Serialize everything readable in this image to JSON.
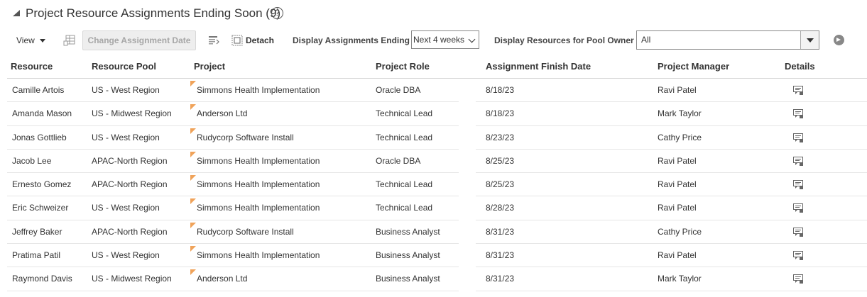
{
  "header": {
    "title": "Project Resource Assignments Ending Soon (9)",
    "help_symbol": "?"
  },
  "toolbar": {
    "view_label": "View",
    "change_date_label": "Change Assignment Date",
    "detach_label": "Detach",
    "ending_label": "Display Assignments Ending",
    "ending_value": "Next 4 weeks",
    "pool_owner_label": "Display Resources for Pool Owner",
    "pool_owner_value": "All"
  },
  "columns": {
    "resource": "Resource",
    "pool": "Resource Pool",
    "project": "Project",
    "role": "Project Role",
    "finish": "Assignment Finish Date",
    "manager": "Project Manager",
    "details": "Details"
  },
  "rows": [
    {
      "resource": "Camille Artois",
      "pool": "US - West Region",
      "project": "Simmons Health Implementation",
      "role": "Oracle DBA",
      "finish": "8/18/23",
      "manager": "Ravi Patel"
    },
    {
      "resource": "Amanda Mason",
      "pool": "US - Midwest Region",
      "project": "Anderson Ltd",
      "role": "Technical Lead",
      "finish": "8/18/23",
      "manager": "Mark Taylor"
    },
    {
      "resource": "Jonas Gottlieb",
      "pool": "US - West Region",
      "project": "Rudycorp Software Install",
      "role": "Technical Lead",
      "finish": "8/23/23",
      "manager": "Cathy Price"
    },
    {
      "resource": "Jacob Lee",
      "pool": "APAC-North Region",
      "project": "Simmons Health Implementation",
      "role": "Oracle DBA",
      "finish": "8/25/23",
      "manager": "Ravi Patel"
    },
    {
      "resource": "Ernesto Gomez",
      "pool": "APAC-North Region",
      "project": "Simmons Health Implementation",
      "role": "Technical Lead",
      "finish": "8/25/23",
      "manager": "Ravi Patel"
    },
    {
      "resource": "Eric Schweizer",
      "pool": "US - West Region",
      "project": "Simmons Health Implementation",
      "role": "Technical Lead",
      "finish": "8/28/23",
      "manager": "Ravi Patel"
    },
    {
      "resource": "Jeffrey Baker",
      "pool": "APAC-North Region",
      "project": "Rudycorp Software Install",
      "role": "Business Analyst",
      "finish": "8/31/23",
      "manager": "Cathy Price"
    },
    {
      "resource": "Pratima Patil",
      "pool": "US - West Region",
      "project": "Simmons Health Implementation",
      "role": "Business Analyst",
      "finish": "8/31/23",
      "manager": "Ravi Patel"
    },
    {
      "resource": "Raymond Davis",
      "pool": "US - Midwest Region",
      "project": "Anderson Ltd",
      "role": "Business Analyst",
      "finish": "8/31/23",
      "manager": "Mark Taylor"
    }
  ]
}
